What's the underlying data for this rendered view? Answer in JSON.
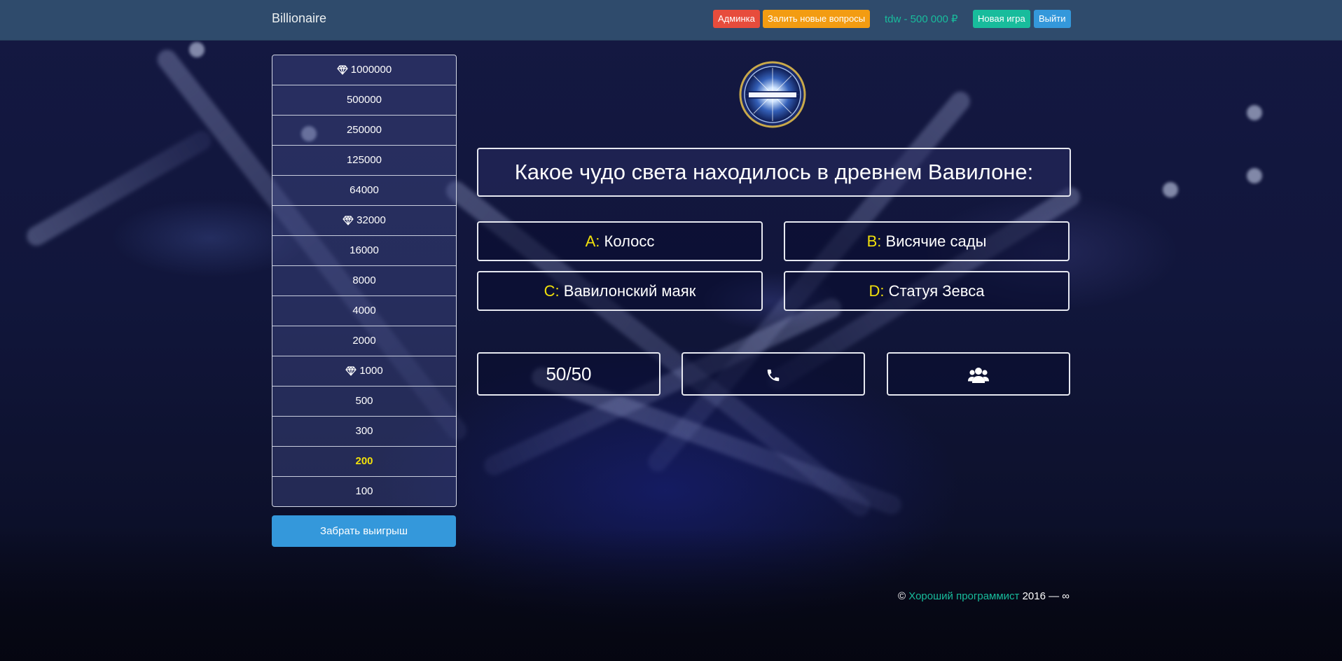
{
  "navbar": {
    "brand": "Billionaire",
    "admin_label": "Админка",
    "upload_label": "Залить новые вопросы",
    "user_info": "tdw - 500 000 ₽",
    "new_game_label": "Новая игра",
    "logout_label": "Выйти"
  },
  "ladder": {
    "rungs": [
      {
        "amount": "1000000",
        "milestone": true
      },
      {
        "amount": "500000",
        "milestone": false
      },
      {
        "amount": "250000",
        "milestone": false
      },
      {
        "amount": "125000",
        "milestone": false
      },
      {
        "amount": "64000",
        "milestone": false
      },
      {
        "amount": "32000",
        "milestone": true
      },
      {
        "amount": "16000",
        "milestone": false
      },
      {
        "amount": "8000",
        "milestone": false
      },
      {
        "amount": "4000",
        "milestone": false
      },
      {
        "amount": "2000",
        "milestone": false
      },
      {
        "amount": "1000",
        "milestone": true
      },
      {
        "amount": "500",
        "milestone": false
      },
      {
        "amount": "300",
        "milestone": false
      },
      {
        "amount": "200",
        "milestone": false,
        "current": true
      },
      {
        "amount": "100",
        "milestone": false
      }
    ],
    "take_money_label": "Забрать выигрыш",
    "milestone_icon": "diamond-icon"
  },
  "logo": {
    "icon": "millionaire-logo"
  },
  "question": {
    "text": "Какое чудо света находилось в древнем Вавилоне:"
  },
  "answers": {
    "a": {
      "letter": "A:",
      "text": "Колосс"
    },
    "b": {
      "letter": "B:",
      "text": "Висячие сады"
    },
    "c": {
      "letter": "C:",
      "text": "Вавилонский маяк"
    },
    "d": {
      "letter": "D:",
      "text": "Статуя Зевса"
    }
  },
  "help": {
    "fifty_label": "50/50",
    "phone_icon": "phone-icon",
    "audience_icon": "users-icon"
  },
  "footer": {
    "copyright": "©",
    "author": "Хороший программист",
    "years": "2016 — ∞"
  },
  "colors": {
    "navbar": "#2f4b6c",
    "accent_green": "#18bc9c",
    "accent_blue": "#3498db",
    "danger": "#e74c3c",
    "warning": "#f39c12",
    "answer_letter": "#f1e00b"
  }
}
